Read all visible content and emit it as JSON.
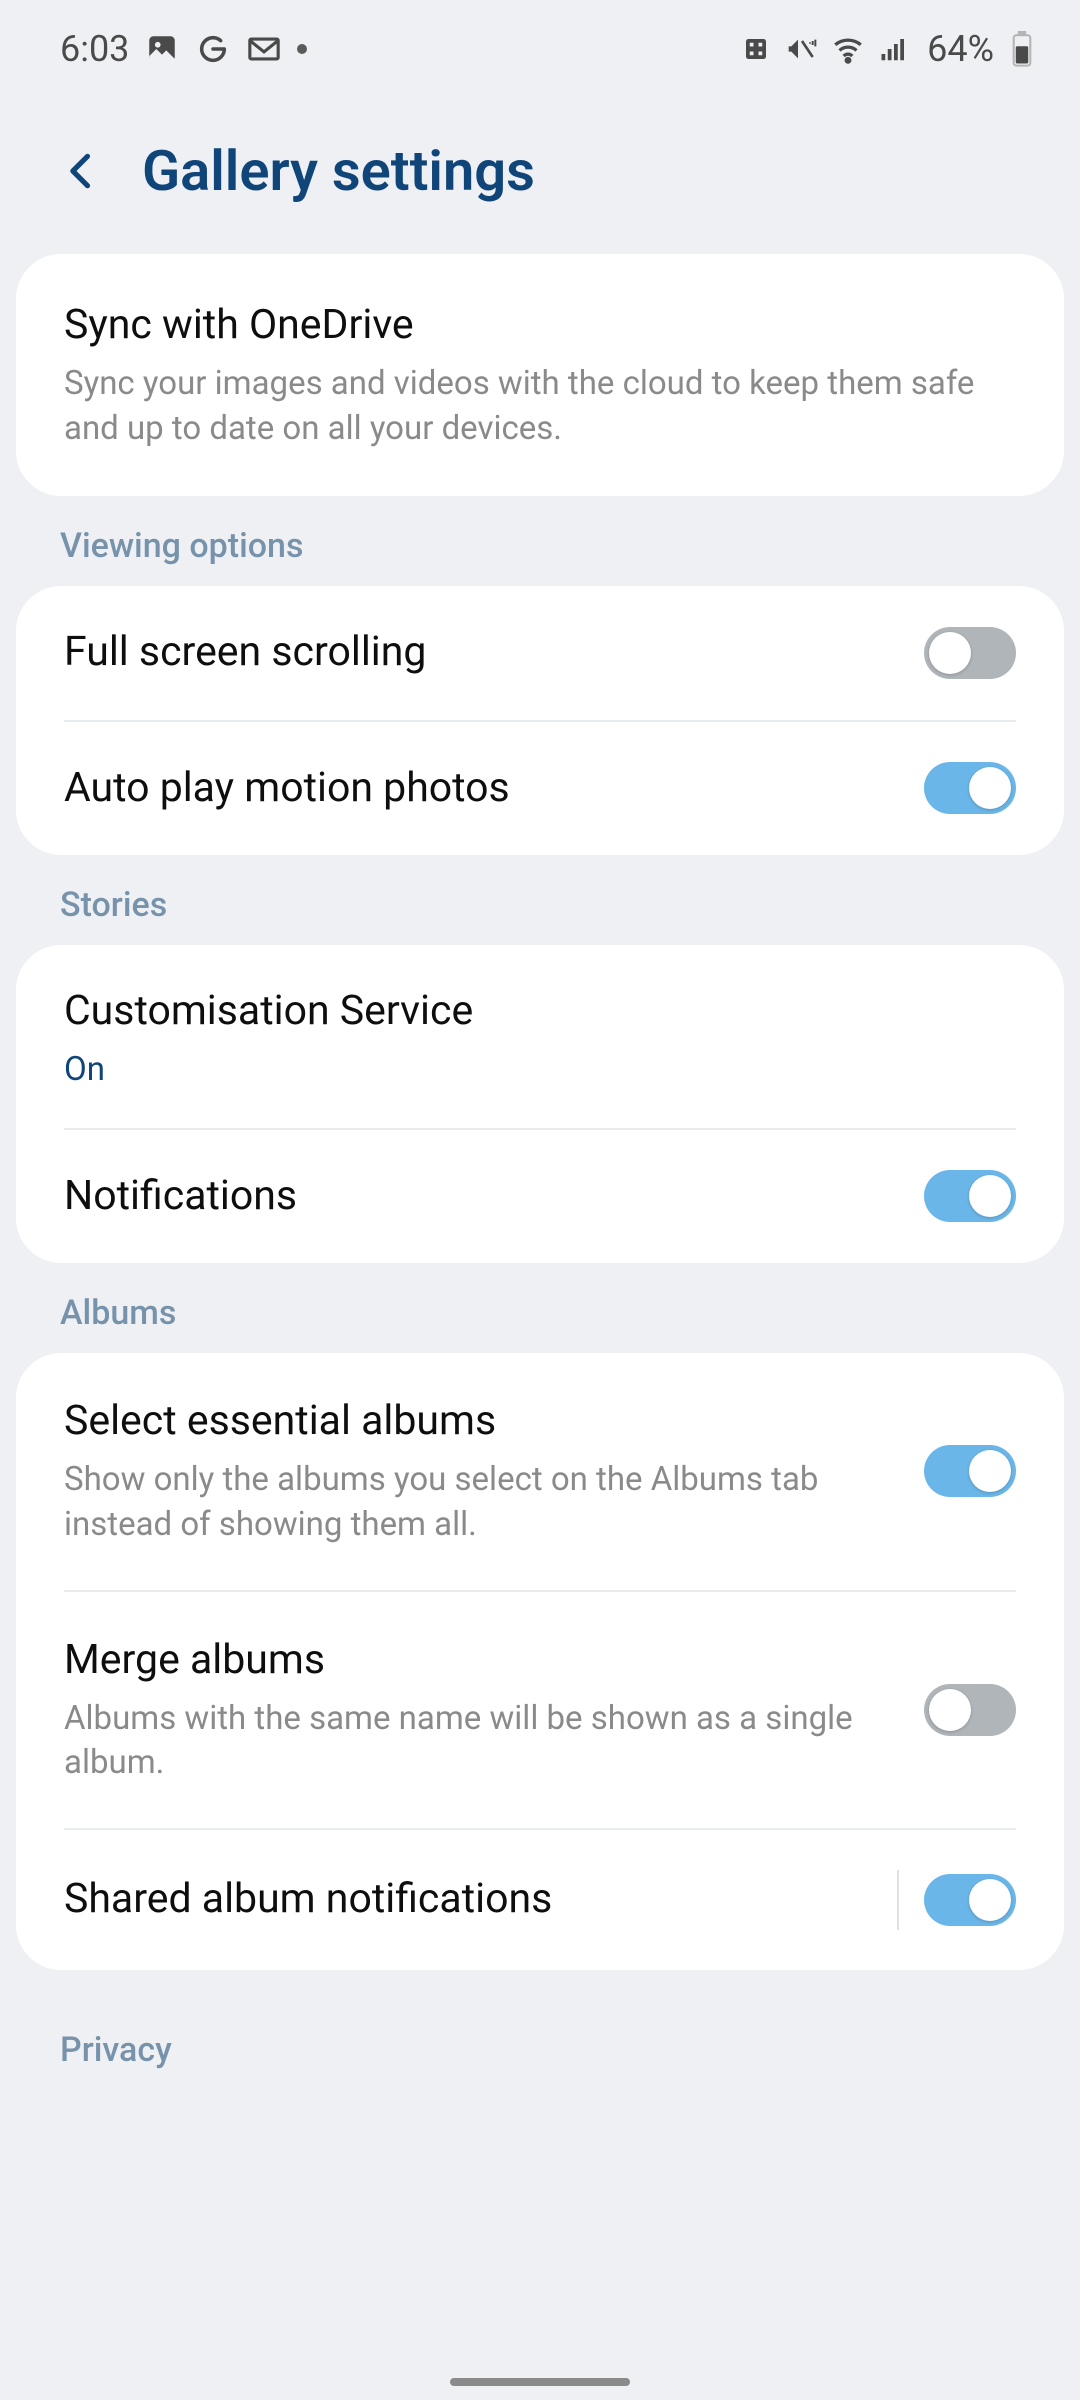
{
  "status": {
    "time": "6:03",
    "battery_pct": "64%"
  },
  "header": {
    "title": "Gallery settings"
  },
  "sync": {
    "title": "Sync with OneDrive",
    "desc": "Sync your images and videos with the cloud to keep them safe and up to date on all your devices."
  },
  "sections": {
    "viewing": "Viewing options",
    "stories": "Stories",
    "albums": "Albums",
    "privacy": "Privacy"
  },
  "rows": {
    "full_screen_scrolling": {
      "title": "Full screen scrolling",
      "on": false
    },
    "auto_play_motion": {
      "title": "Auto play motion photos",
      "on": true
    },
    "customisation_service": {
      "title": "Customisation Service",
      "status": "On"
    },
    "notifications": {
      "title": "Notifications",
      "on": true
    },
    "select_essential_albums": {
      "title": "Select essential albums",
      "desc": "Show only the albums you select on the Albums tab instead of showing them all.",
      "on": true
    },
    "merge_albums": {
      "title": "Merge albums",
      "desc": "Albums with the same name will be shown as a single album.",
      "on": false
    },
    "shared_album_notifications": {
      "title": "Shared album notifications",
      "on": true
    }
  }
}
